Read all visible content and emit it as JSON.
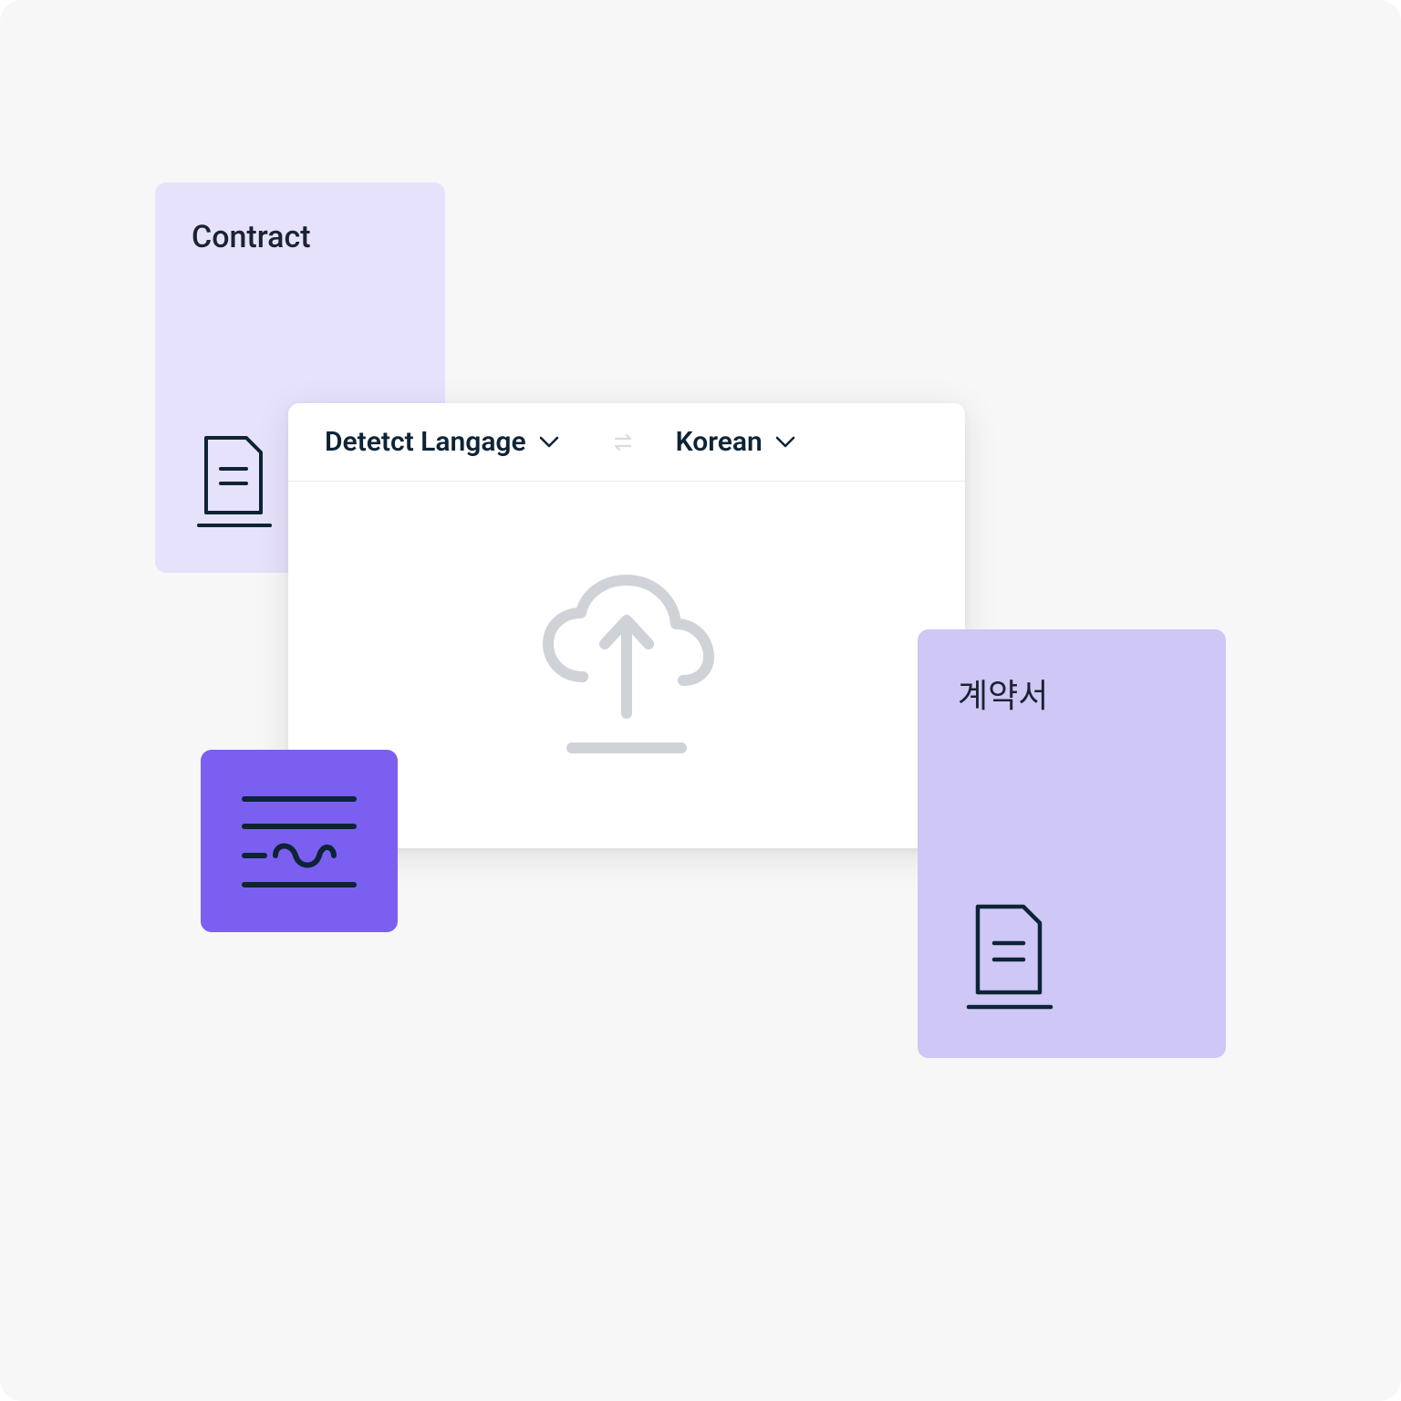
{
  "source_card": {
    "title": "Contract"
  },
  "translator": {
    "source_lang": "Detetct Langage",
    "target_lang": "Korean"
  },
  "target_card": {
    "title": "계약서"
  },
  "colors": {
    "canvas_bg": "#f7f7f8",
    "source_card_bg": "#e7e2fb",
    "target_card_bg": "#cfc7f6",
    "purple_tile_bg": "#7b5ff0",
    "text_dark": "#0d2436",
    "icon_muted": "#cfd2d7"
  }
}
